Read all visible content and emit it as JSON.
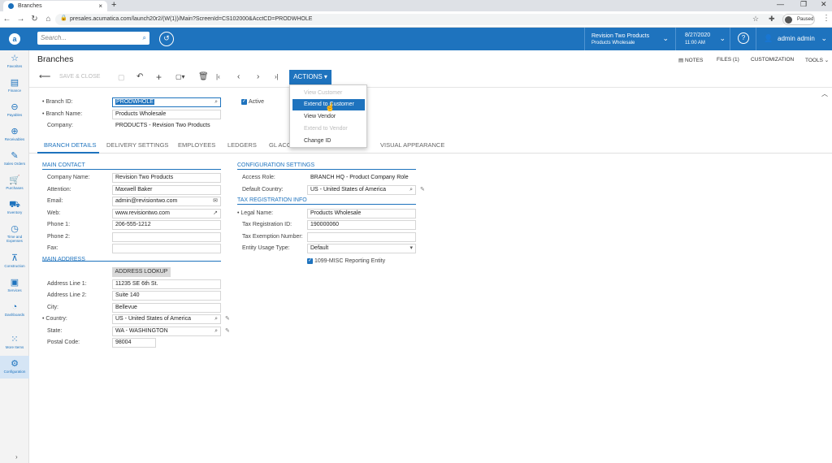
{
  "browser": {
    "tab_title": "Branches",
    "url": "presales.acumatica.com/launch20r2/(W(1))/Main?ScreenId=CS102000&AcctCD=PRODWHOLE",
    "paused_label": "Paused"
  },
  "header": {
    "search_placeholder": "Search...",
    "branch_name": "Revision Two Products",
    "branch_sub": "Products Wholesale",
    "date": "8/27/2020",
    "time": "11:00 AM",
    "user": "admin admin"
  },
  "sidebar": {
    "items": [
      {
        "label": "Favorites",
        "icon": "star-icon"
      },
      {
        "label": "Finance",
        "icon": "finance-icon"
      },
      {
        "label": "Payables",
        "icon": "payables-icon"
      },
      {
        "label": "Receivables",
        "icon": "receivables-icon"
      },
      {
        "label": "Sales Orders",
        "icon": "sales-orders-icon"
      },
      {
        "label": "Purchases",
        "icon": "cart-icon"
      },
      {
        "label": "Inventory",
        "icon": "truck-icon"
      },
      {
        "label": "Time and Expenses",
        "icon": "clock-icon"
      },
      {
        "label": "Construction",
        "icon": "crane-icon"
      },
      {
        "label": "Services",
        "icon": "briefcase-icon"
      },
      {
        "label": "Dashboards",
        "icon": "gauge-icon"
      },
      {
        "label": "More Items",
        "icon": "grid-icon"
      },
      {
        "label": "Configuration",
        "icon": "gear-icon"
      }
    ]
  },
  "page": {
    "title": "Branches",
    "links": {
      "notes": "NOTES",
      "files": "FILES (1)",
      "customization": "CUSTOMIZATION",
      "tools": "TOOLS"
    }
  },
  "toolbar": {
    "save_close": "SAVE & CLOSE",
    "actions": "ACTIONS"
  },
  "actions_menu": {
    "items": [
      {
        "label": "View Customer",
        "enabled": false
      },
      {
        "label": "Extend to Customer",
        "enabled": true
      },
      {
        "label": "View Vendor",
        "enabled": true
      },
      {
        "label": "Extend to Vendor",
        "enabled": false
      },
      {
        "label": "Change ID",
        "enabled": true
      }
    ]
  },
  "summary": {
    "branch_id_label": "Branch ID:",
    "branch_id": "PRODWHOLE",
    "branch_name_label": "Branch Name:",
    "branch_name": "Products Wholesale",
    "company_label": "Company:",
    "company": "PRODUCTS - Revision Two Products",
    "active_label": "Active"
  },
  "tabs": [
    "BRANCH DETAILS",
    "DELIVERY SETTINGS",
    "EMPLOYEES",
    "LEDGERS",
    "GL ACCO",
    "VISUAL APPEARANCE"
  ],
  "main_contact": {
    "title": "MAIN CONTACT",
    "company_name_label": "Company Name:",
    "company_name": "Revision Two Products",
    "attention_label": "Attention:",
    "attention": "Maxwell Baker",
    "email_label": "Email:",
    "email": "admin@revisiontwo.com",
    "web_label": "Web:",
    "web": "www.revisiontwo.com",
    "phone1_label": "Phone 1:",
    "phone1": "206-555-1212",
    "phone2_label": "Phone 2:",
    "phone2": "",
    "fax_label": "Fax:",
    "fax": ""
  },
  "main_address": {
    "title": "MAIN ADDRESS",
    "lookup": "ADDRESS LOOKUP",
    "line1_label": "Address Line 1:",
    "line1": "11235 SE 6th St.",
    "line2_label": "Address Line 2:",
    "line2": "Suite 140",
    "city_label": "City:",
    "city": "Bellevue",
    "country_label": "Country:",
    "country": "US - United States of America",
    "state_label": "State:",
    "state": "WA - WASHINGTON",
    "postal_label": "Postal Code:",
    "postal": "98004"
  },
  "config": {
    "title": "CONFIGURATION SETTINGS",
    "access_role_label": "Access Role:",
    "access_role": "BRANCH HQ - Product Company Role",
    "default_country_label": "Default Country:",
    "default_country": "US - United States of America"
  },
  "tax": {
    "title": "TAX REGISTRATION INFO",
    "legal_name_label": "Legal Name:",
    "legal_name": "Products Wholesale",
    "tax_reg_label": "Tax Registration ID:",
    "tax_reg": "190000060",
    "tax_exempt_label": "Tax Exemption Number:",
    "tax_exempt": "",
    "entity_usage_label": "Entity Usage Type:",
    "entity_usage": "Default",
    "misc_label": "1099-MISC Reporting Entity"
  },
  "colors": {
    "accent": "#1e73be",
    "header": "#1e73be",
    "sidebar": "#f3f3f3"
  }
}
